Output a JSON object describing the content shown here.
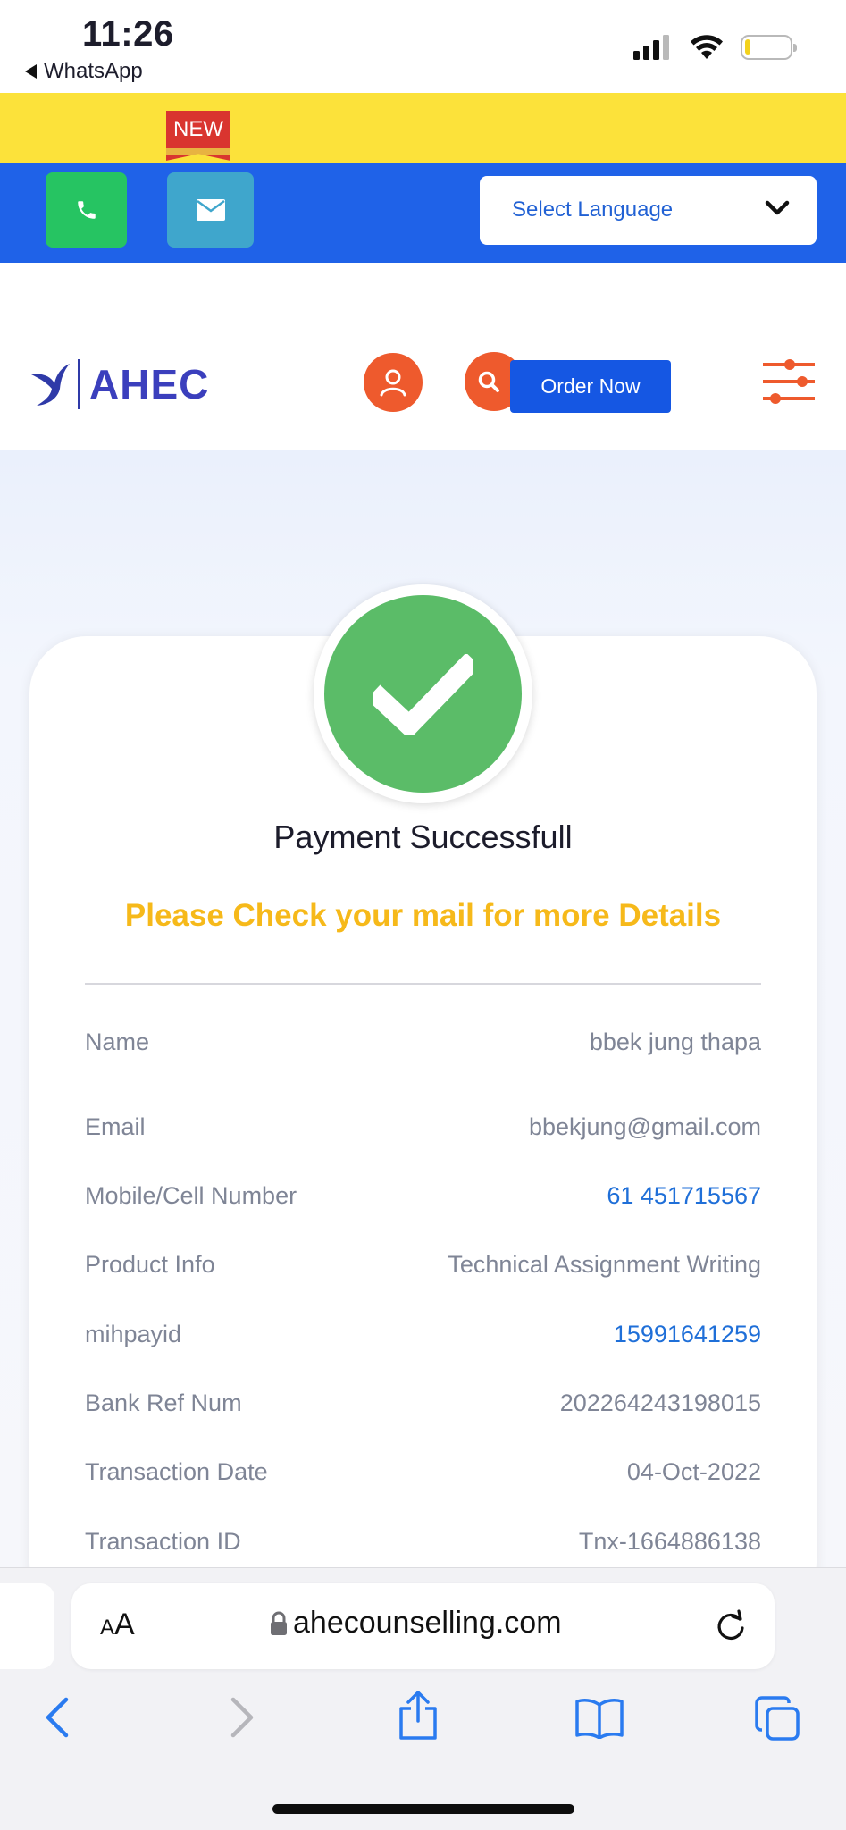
{
  "status_bar": {
    "time": "11:26",
    "back_app": "WhatsApp"
  },
  "promo": {
    "new_badge": "NEW"
  },
  "contact": {
    "language_select": "Select Language"
  },
  "header": {
    "logo_text": "AHEC",
    "order_button": "Order Now"
  },
  "payment": {
    "title": "Payment Successfull",
    "subtitle": "Please Check your mail for more Details",
    "details": [
      {
        "label": "Name",
        "value": "bbek jung thapa",
        "link": false
      },
      {
        "label": "Email",
        "value": "bbekjung@gmail.com",
        "link": false
      },
      {
        "label": "Mobile/Cell Number",
        "value": "61 451715567",
        "link": true
      },
      {
        "label": "Product Info",
        "value": "Technical Assignment Writing",
        "link": false
      },
      {
        "label": "mihpayid",
        "value": "15991641259",
        "link": true
      },
      {
        "label": "Bank Ref Num",
        "value": "202264243198015",
        "link": false
      },
      {
        "label": "Transaction Date",
        "value": "04-Oct-2022",
        "link": false
      },
      {
        "label": "Transaction ID",
        "value": "Tnx-1664886138",
        "link": false
      }
    ]
  },
  "browser": {
    "text_size_label": "AA",
    "url": "ahecounselling.com"
  },
  "colors": {
    "promo_yellow": "#fce23a",
    "contact_blue": "#1f62e8",
    "call_green": "#26c462",
    "mail_teal": "#3fa6cc",
    "accent_orange": "#ee5a2d",
    "success_green": "#5bbc68",
    "subtitle_yellow": "#f6b91a",
    "link_blue": "#1f6fd8"
  },
  "icons": [
    "signal-icon",
    "wifi-icon",
    "battery-icon",
    "phone-icon",
    "envelope-icon",
    "chevron-down-icon",
    "user-icon",
    "search-icon",
    "filter-menu-icon",
    "checkmark-icon",
    "lock-icon",
    "reload-icon",
    "back-icon",
    "forward-icon",
    "share-icon",
    "bookmarks-icon",
    "tabs-icon"
  ]
}
